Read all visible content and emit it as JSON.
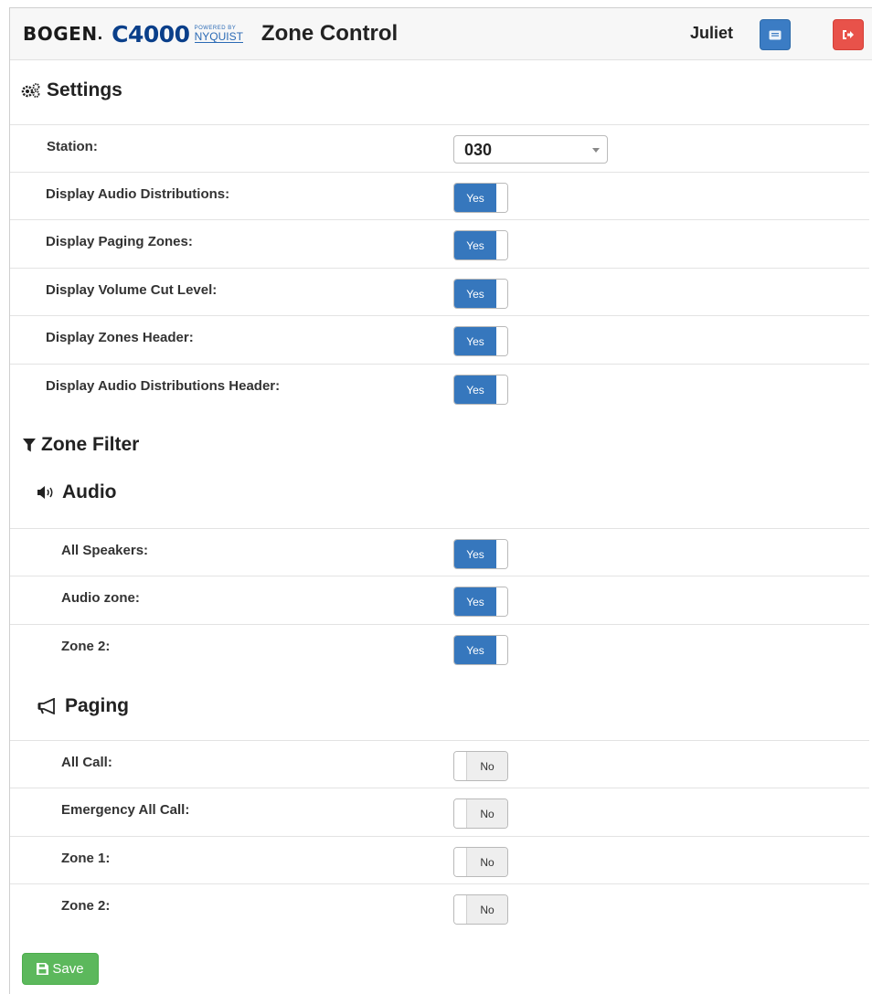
{
  "header": {
    "brand_bogen": "BOGEN",
    "brand_dot": ".",
    "brand_product": "C4000",
    "brand_powered": "POWERED BY",
    "brand_nyquist": "NYQUIST",
    "title": "Zone Control",
    "user": "Juliet",
    "icons": {
      "message": "message-icon",
      "logout": "logout-icon"
    },
    "colors": {
      "message_button": "#3b7cc4",
      "logout_button": "#e8524a"
    }
  },
  "settings": {
    "title": "Settings",
    "icon": "gears-icon",
    "station": {
      "label": "Station:",
      "value": "030"
    },
    "rows": [
      {
        "label": "Display Audio Distributions:",
        "state": "Yes"
      },
      {
        "label": "Display Paging Zones:",
        "state": "Yes"
      },
      {
        "label": "Display Volume Cut Level:",
        "state": "Yes"
      },
      {
        "label": "Display Zones Header:",
        "state": "Yes"
      },
      {
        "label": "Display Audio Distributions Header:",
        "state": "Yes"
      }
    ]
  },
  "zone_filter": {
    "title": "Zone Filter",
    "icon": "filter-icon",
    "audio": {
      "title": "Audio",
      "icon": "speaker-icon",
      "rows": [
        {
          "label": "All Speakers:",
          "state": "Yes"
        },
        {
          "label": "Audio zone:",
          "state": "Yes"
        },
        {
          "label": "Zone 2:",
          "state": "Yes"
        }
      ]
    },
    "paging": {
      "title": "Paging",
      "icon": "megaphone-icon",
      "rows": [
        {
          "label": "All Call:",
          "state": "No"
        },
        {
          "label": "Emergency All Call:",
          "state": "No"
        },
        {
          "label": "Zone 1:",
          "state": "No"
        },
        {
          "label": "Zone 2:",
          "state": "No"
        }
      ]
    }
  },
  "save": {
    "label": "Save",
    "icon": "floppy-disk-icon",
    "color": "#5cb85c"
  },
  "toggle_on_color": "#3677bd"
}
